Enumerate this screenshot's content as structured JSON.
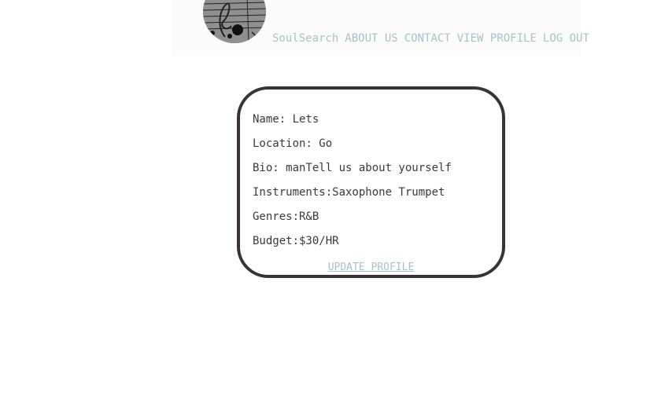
{
  "nav": {
    "logo_icon": "music-staff-logo",
    "links": [
      "SoulSearch",
      "ABOUT US",
      "CONTACT",
      "VIEW PROFILE",
      "LOG OUT"
    ],
    "link_color": "#a9c2c8"
  },
  "profile": {
    "name": "Name: Lets",
    "location": "Location: Go",
    "bio": "Bio: manTell us about yourself",
    "instruments": "Instruments:Saxophone Trumpet",
    "genres": "Genres:R&B",
    "budget": "Budget:$30/HR",
    "update_label": "UPDATE PROFILE",
    "border_color": "#3a3233"
  }
}
